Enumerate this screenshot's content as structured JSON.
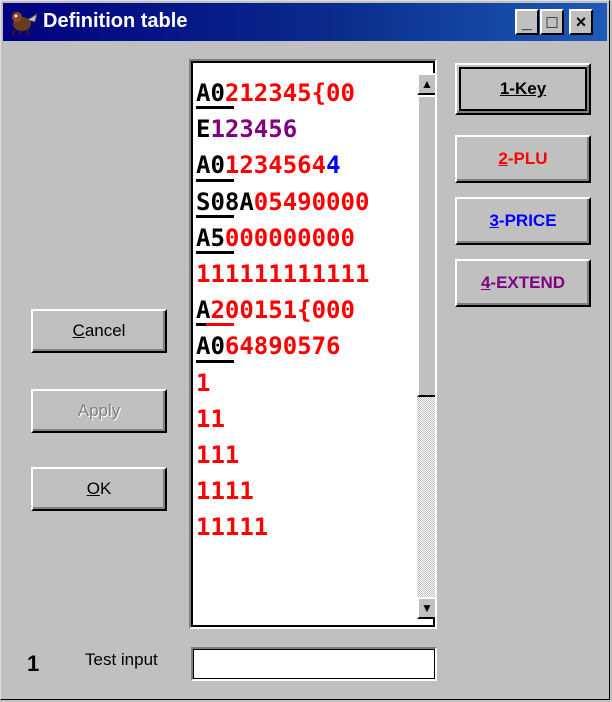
{
  "window": {
    "title": "Definition table",
    "minimize_label": "_",
    "maximize_label": "□",
    "close_label": "×"
  },
  "colors": {
    "title_bar": "#000080",
    "key_text": "#000000",
    "plu_text": "#ff0000",
    "price_text": "#0000ff",
    "extend_text": "#800080"
  },
  "left_buttons": {
    "cancel_hotkey": "C",
    "cancel_rest": "ancel",
    "apply_label": "Apply",
    "ok_hotkey": "O",
    "ok_rest": "K"
  },
  "right_buttons": {
    "key_label": "1-Key",
    "plu_num": "2",
    "plu_rest": "-PLU",
    "price_num": "3",
    "price_rest": "-PRICE",
    "extend_num": "4",
    "extend_rest": "-EXTEND"
  },
  "list": {
    "rows": [
      [
        {
          "t": "A0",
          "c": "black"
        },
        {
          "t": "212345{00",
          "c": "red"
        }
      ],
      [
        {
          "t": "E",
          "c": "black"
        },
        {
          "t": "123456",
          "c": "purple"
        }
      ],
      [
        {
          "t": "A0",
          "c": "black"
        },
        {
          "t": "1234564",
          "c": "red"
        },
        {
          "t": "4",
          "c": "blue"
        }
      ],
      [
        {
          "t": "S08A",
          "c": "black"
        },
        {
          "t": "05490000",
          "c": "red"
        }
      ],
      [
        {
          "t": "A5",
          "c": "black"
        },
        {
          "t": "000000000",
          "c": "red"
        }
      ],
      [
        {
          "t": "111111111111",
          "c": "red"
        }
      ],
      [
        {
          "t": "A",
          "c": "black"
        },
        {
          "t": "200151{000",
          "c": "red"
        }
      ],
      [
        {
          "t": "A0",
          "c": "black"
        },
        {
          "t": "64890576",
          "c": "red"
        }
      ],
      [
        {
          "t": "1",
          "c": "red"
        }
      ],
      [
        {
          "t": "11",
          "c": "red"
        }
      ],
      [
        {
          "t": "111",
          "c": "red"
        }
      ],
      [
        {
          "t": "1111",
          "c": "red"
        }
      ],
      [
        {
          "t": "11111",
          "c": "red"
        }
      ]
    ],
    "underlined_rows": [
      0,
      2,
      3,
      4,
      6,
      7
    ],
    "red_underlined_rows": [
      6
    ]
  },
  "scroll": {
    "up_arrow": "▲",
    "down_arrow": "▼",
    "left_arrow": "◀",
    "right_arrow": "▶"
  },
  "footer": {
    "number": "1",
    "test_label": "Test input",
    "test_value": ""
  }
}
